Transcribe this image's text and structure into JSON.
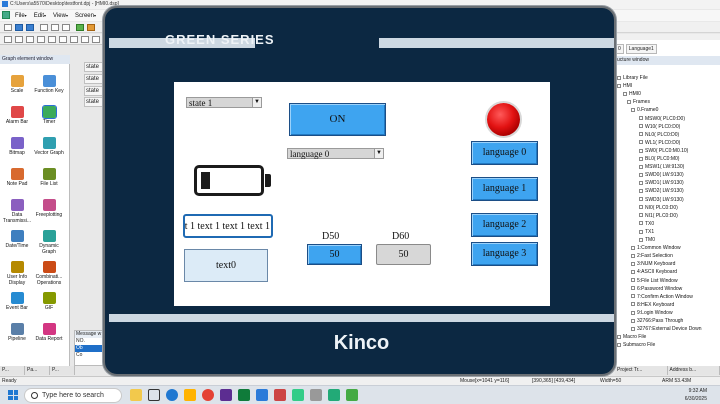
{
  "ide": {
    "title": "C:\\Users\\a5570\\Desktop\\testfont.dpj - [HMI0.dsp]",
    "menu": [
      "File",
      "Edit",
      "View",
      "Screen"
    ],
    "graph_element_window": {
      "title": "Graph element window",
      "elements": [
        {
          "label": "Scale",
          "icon": "scale-icon"
        },
        {
          "label": "Function Key",
          "icon": "function-key-icon"
        },
        {
          "label": "Alarm Bar",
          "icon": "alarm-bar-icon"
        },
        {
          "label": "Timer",
          "icon": "timer-icon"
        },
        {
          "label": "Bitmap",
          "icon": "bitmap-icon"
        },
        {
          "label": "Vector Graph",
          "icon": "vector-graph-icon"
        },
        {
          "label": "Note Pad",
          "icon": "note-pad-icon"
        },
        {
          "label": "File List",
          "icon": "file-list-icon"
        },
        {
          "label": "Data Transmissi...",
          "icon": "data-transmission-icon"
        },
        {
          "label": "Freeplotting",
          "icon": "freeplotting-icon"
        },
        {
          "label": "Date/Time",
          "icon": "date-time-icon"
        },
        {
          "label": "Dynamic Graph",
          "icon": "dynamic-graph-icon"
        },
        {
          "label": "User Info Display",
          "icon": "user-info-icon"
        },
        {
          "label": "Combinati... Operations",
          "icon": "combination-icon"
        },
        {
          "label": "Event Bar",
          "icon": "event-bar-icon"
        },
        {
          "label": "GIF",
          "icon": "gif-icon"
        },
        {
          "label": "Pipeline",
          "icon": "pipeline-icon"
        },
        {
          "label": "Data Report",
          "icon": "data-report-icon"
        }
      ],
      "bottom_tabs": [
        "P...",
        "Pa...",
        "P..."
      ]
    },
    "state_strips": [
      "state",
      "state",
      "state",
      "state"
    ],
    "message_window": {
      "title": "Message w",
      "rows": [
        "NO.",
        "Ob",
        "Co"
      ]
    },
    "structure_window": {
      "tabs": [
        "0",
        "Language1",
        ""
      ],
      "title": "ucture window",
      "items": [
        "Library File",
        "HMI",
        "HMI0",
        "Frames",
        "0.Frame0",
        "MSW0( PLC0:D0)",
        "W10( PLC0:D0)",
        "NL0( PLC0:D0)",
        "WL1( PLC0:D0)",
        "SW0( PLC0:M0.10)",
        "BL0( PLC0:M0)",
        "MSW1( LW:9130)",
        "SWD0( LW:9130)",
        "SWD1( LW:9130)",
        "SWD2( LW:9130)",
        "SWD3( LW:9130)",
        "NI0( PLC0:D0)",
        "NI1( PLC0:D0)",
        "TX0",
        "TX1",
        "TM0",
        "1:Common Window",
        "2:Fast Selection",
        "3:NUM Keyboard",
        "4:ASCII Keyboard",
        "5:File List Window",
        "6:Password Window",
        "7:Confirm Action Window",
        "8:HEX Keyboard",
        "9:Login Window",
        "32766:Pass Through",
        "32767:External Device Down",
        "Macro File",
        "Submacro File"
      ],
      "bottom_tabs": [
        "Project Tr...",
        "Address b..."
      ]
    },
    "status_bar": {
      "left": "Ready",
      "mouse": "Mouse[x=1041 y=116]",
      "pos": "[390,365] [439,434]",
      "width": "Width=50",
      "cpu": "ARM 53.43M"
    },
    "taskbar": {
      "search_placeholder": "Type here to search",
      "time": "9:32 AM",
      "date": "6/30/2025"
    }
  },
  "hmi": {
    "series_title": "GREEN  SERIES",
    "brand": "Kinco",
    "screen": {
      "state_combo": "state 1",
      "on_button": "ON",
      "language_combo": "language 0",
      "language_buttons": [
        "language 0",
        "language 1",
        "language 2",
        "language 3"
      ],
      "text_field": "t 1 text 1 text 1 text 1",
      "text_button": "text0",
      "d50_label": "D50",
      "d50_value": "50",
      "d60_label": "D60",
      "d60_value": "50",
      "lamp_color": "#e21212",
      "battery_level": 0.15
    }
  }
}
